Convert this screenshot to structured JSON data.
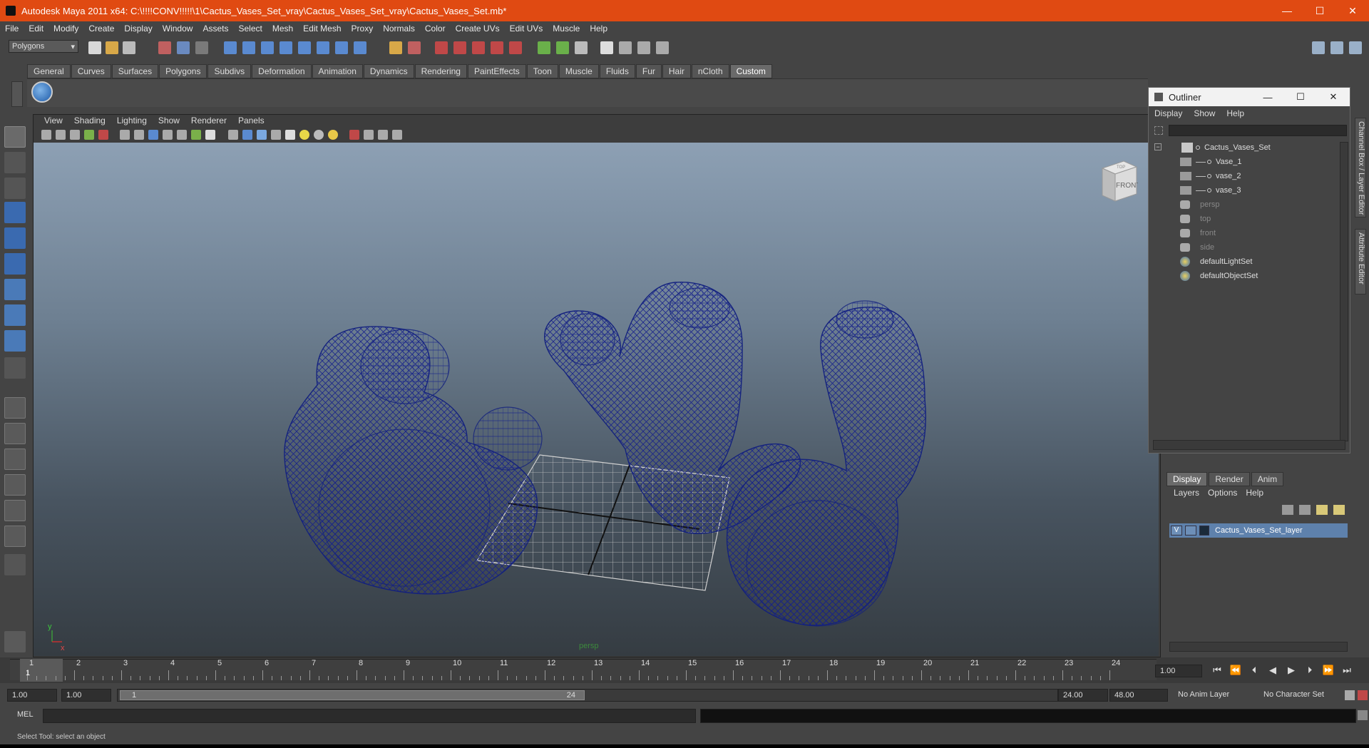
{
  "window": {
    "title": "Autodesk Maya 2011 x64: C:\\!!!!CONV!!!!!\\1\\Cactus_Vases_Set_vray\\Cactus_Vases_Set_vray\\Cactus_Vases_Set.mb*",
    "minimize": "—",
    "maximize": "☐",
    "close": "✕"
  },
  "menubar": [
    "File",
    "Edit",
    "Modify",
    "Create",
    "Display",
    "Window",
    "Assets",
    "Select",
    "Mesh",
    "Edit Mesh",
    "Proxy",
    "Normals",
    "Color",
    "Create UVs",
    "Edit UVs",
    "Muscle",
    "Help"
  ],
  "statusline": {
    "mode": "Polygons"
  },
  "shelf": {
    "tabs": [
      "General",
      "Curves",
      "Surfaces",
      "Polygons",
      "Subdivs",
      "Deformation",
      "Animation",
      "Dynamics",
      "Rendering",
      "PaintEffects",
      "Toon",
      "Muscle",
      "Fluids",
      "Fur",
      "Hair",
      "nCloth",
      "Custom"
    ],
    "active": "Custom"
  },
  "viewport": {
    "menu": [
      "View",
      "Shading",
      "Lighting",
      "Show",
      "Renderer",
      "Panels"
    ],
    "camera_label": "persp",
    "viewcube_front": "FRONT",
    "viewcube_top": "TOP",
    "axis_y": "y",
    "axis_x": "x"
  },
  "outliner": {
    "title": "Outliner",
    "menu": [
      "Display",
      "Show",
      "Help"
    ],
    "items": [
      {
        "label": "Cactus_Vases_Set",
        "depth": 0,
        "dim": false
      },
      {
        "label": "Vase_1",
        "depth": 1,
        "dim": false
      },
      {
        "label": "vase_2",
        "depth": 1,
        "dim": false
      },
      {
        "label": "vase_3",
        "depth": 1,
        "dim": false
      },
      {
        "label": "persp",
        "depth": 0,
        "dim": true
      },
      {
        "label": "top",
        "depth": 0,
        "dim": true
      },
      {
        "label": "front",
        "depth": 0,
        "dim": true
      },
      {
        "label": "side",
        "depth": 0,
        "dim": true
      },
      {
        "label": "defaultLightSet",
        "depth": 0,
        "dim": false
      },
      {
        "label": "defaultObjectSet",
        "depth": 0,
        "dim": false
      }
    ]
  },
  "sidetabs": {
    "channel_box": "Channel Box / Layer Editor",
    "attribute_editor": "Attribute Editor"
  },
  "layer_editor": {
    "tabs": [
      "Display",
      "Render",
      "Anim"
    ],
    "active": "Display",
    "menu": [
      "Layers",
      "Options",
      "Help"
    ],
    "layer": {
      "visible": "V",
      "name": "Cactus_Vases_Set_layer"
    }
  },
  "timeline": {
    "ticks": [
      "1",
      "2",
      "3",
      "4",
      "5",
      "6",
      "7",
      "8",
      "9",
      "10",
      "11",
      "12",
      "13",
      "14",
      "15",
      "16",
      "17",
      "18",
      "19",
      "20",
      "21",
      "22",
      "23",
      "24"
    ],
    "current_frame": "1",
    "current_field": "1.00"
  },
  "range": {
    "start": "1.00",
    "playback_start": "1.00",
    "slider_start": "1",
    "slider_end": "24",
    "playback_end": "24.00",
    "end": "48.00",
    "anim_layer": "No Anim Layer",
    "character_set": "No Character Set"
  },
  "command": {
    "label": "MEL"
  },
  "helpline": {
    "text": "Select Tool: select an object"
  },
  "colors": {
    "titlebar": "#e04a12",
    "wireframe": "#1a1f8a",
    "layer_highlight": "#5e81ac"
  }
}
